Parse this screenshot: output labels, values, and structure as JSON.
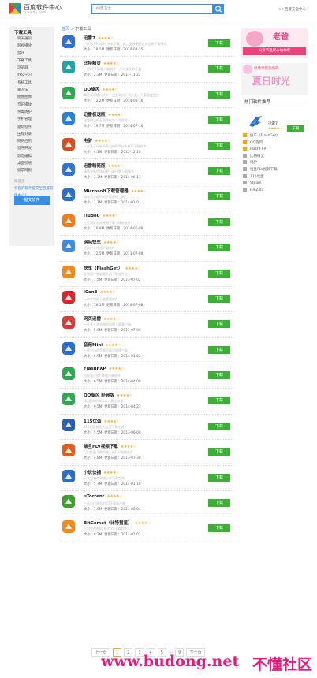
{
  "header": {
    "site_name": "百度软件中心",
    "site_domain": "rj.baidu.com",
    "search_value": "百度卫士",
    "top_link": ">>百度安全中心"
  },
  "sidebar": {
    "title": "下载工具",
    "items": [
      "聊天通讯",
      "影视播放",
      "游戏",
      "下载工具",
      "浏览器",
      "办公学习",
      "系统工具",
      "输入法",
      "图像图像",
      "音乐播放",
      "杀毒防护",
      "手机管理",
      "驱动程序",
      "压缩刻录",
      "网络应用",
      "程序开发",
      "影音编辑",
      "桌面壁纸",
      "股票网银"
    ],
    "welcome": "欢迎您",
    "publish": "将您的软件提交至百度软件中心！",
    "submit_label": "提交软件"
  },
  "breadcrumb": {
    "home": "首页",
    "sep": ">",
    "current": "下载工具"
  },
  "software": [
    {
      "name": "迅雷7",
      "stars": "★★★★☆",
      "desc": "一款基于P2SP技术的下载工具，更快更稳定的全新下载体验",
      "size": "28.5M",
      "date": "2014-07-25",
      "icon": "xunlei-icon",
      "color": "#2f6fd0"
    },
    {
      "name": "比特精灵",
      "stars": "★★★★☆",
      "desc": "一款BT下载客户端软件，支持多任务下载",
      "size": "2.3M",
      "date": "2013-11-22",
      "icon": "bitspirit-icon",
      "color": "#1fa3a3"
    },
    {
      "name": "QQ旋风",
      "stars": "★★★★☆",
      "desc": "腾讯公司推出的新一代互联网下载工具，下载速度更快",
      "size": "12.2M",
      "date": "2014-05-16",
      "icon": "qqxuanfeng-icon",
      "color": "#2fa84f"
    },
    {
      "name": "迅雷极速版",
      "stars": "★★★★☆",
      "desc": "迅雷推出的无插件纯净下载版本",
      "size": "19.7M",
      "date": "2014-07-16",
      "icon": "xunlei-speed-icon",
      "color": "#2a7fd9"
    },
    {
      "name": "电驴",
      "stars": "★★★★☆",
      "desc": "一款基于eMule开发的P2P文件共享下载软件",
      "size": "4.1M",
      "date": "2013-12-10",
      "icon": "verycd-icon",
      "color": "#d94c1f"
    },
    {
      "name": "迅雷精简版",
      "stars": "★★★★☆",
      "desc": "精简安装包体积更小的迅雷下载版本",
      "size": "3.3M",
      "date": "2014-06-13",
      "icon": "xunlei-mini-icon",
      "color": "#2e73d6"
    },
    {
      "name": "Microsoft下载管理器",
      "stars": "★★★★☆",
      "desc": "微软官方提供的下载管理工具",
      "size": "1.2M",
      "date": "2014-01-01",
      "icon": "ms-download-icon",
      "color": "#2a6fc9"
    },
    {
      "name": "iTudou",
      "stars": "★★★★☆",
      "desc": "土豆网推出的视频下载与播放软件",
      "size": "16.8M",
      "date": "2014-06-08",
      "icon": "itudou-icon",
      "color": "#f07c1a"
    },
    {
      "name": "网际快车",
      "stars": "★★★★☆",
      "desc": "经典的多线程下载软件",
      "size": "12.5M",
      "date": "2013-07-09",
      "icon": "flashget-old-icon",
      "color": "#3f8be0"
    },
    {
      "name": "快车（FlashGet）",
      "stars": "★★★★☆",
      "desc": "全球用户数量最多的下载软件之一",
      "size": "7.5M",
      "date": "2013-07-02",
      "icon": "flashget-icon",
      "color": "#f08a1c"
    },
    {
      "name": "iCon3",
      "stars": "★★★★☆",
      "desc": "一款实用的下载管理软件",
      "size": "18.1M",
      "date": "2014-07-08",
      "icon": "icon3-icon",
      "color": "#d9262c"
    },
    {
      "name": "网页迅雷",
      "stars": "★★★★☆",
      "desc": "一款基于浏览器的迅雷下载客户端",
      "size": "5.9M",
      "date": "2013-07-09",
      "icon": "web-xunlei-icon",
      "color": "#d93a3a"
    },
    {
      "name": "音频Mini",
      "stars": "★★★★☆",
      "desc": "一款小巧的音频下载与管理工具",
      "size": "6.9M",
      "date": "2014-01-02",
      "icon": "audio-mini-icon",
      "color": "#2a6fd0"
    },
    {
      "name": "FlashFXP",
      "stars": "★★★★☆",
      "desc": "功能强大的FTP客户端软件",
      "size": "6.5M",
      "date": "2014-04-09",
      "icon": "flashfxp-icon",
      "color": "#2fa84f"
    },
    {
      "name": "QQ旋风 经典版",
      "stars": "★★★★☆",
      "desc": "QQ旋风经典版本，稳定快速",
      "size": "9.5M",
      "date": "2014-04-23",
      "icon": "qqxuanfeng-classic-icon",
      "color": "#2fa84f"
    },
    {
      "name": "115优蛋",
      "stars": "★★★★☆",
      "desc": "115网盘推出的极速下载工具",
      "size": "5.5M",
      "date": "2013-06-09",
      "icon": "115-icon",
      "color": "#2a5fb0"
    },
    {
      "name": "维旦FLV视频下载",
      "stars": "★★★★☆",
      "desc": "可以批量下载网络上的FLV视频文件",
      "size": "4.8M",
      "date": "2013-07-30",
      "icon": "flv-download-icon",
      "color": "#e85a1a"
    },
    {
      "name": "小说快捕",
      "stars": "★★★★☆",
      "desc": "一款方便的网络小说下载工具",
      "size": "5.7M",
      "date": "2014-01-10",
      "icon": "novel-icon",
      "color": "#2a6fc9"
    },
    {
      "name": "uTorrent",
      "stars": "★★★★☆",
      "desc": "一款小巧强劲的BT下载客户端",
      "size": "1.9M",
      "date": "2014-08-04",
      "icon": "utorrent-icon",
      "color": "#3f9e2e"
    },
    {
      "name": "BitComet（比特彗星）",
      "stars": "★★★★☆",
      "desc": "一款免费的BitTorrent下载软件",
      "size": "8.3M",
      "date": "2014-01-02",
      "icon": "bitcomet-icon",
      "color": "#f08a1c"
    }
  ],
  "labels": {
    "download": "下载",
    "size_prefix": "大小：",
    "date_prefix": "更新日期："
  },
  "pager": {
    "prev": "上一页",
    "pages": [
      "1",
      "2",
      "3",
      "4",
      "5"
    ],
    "ellipsis": "...",
    "last": "9",
    "next": "下一页",
    "current": "1"
  },
  "ads": {
    "ad1_title": "老爸",
    "ad1_banner": "父亲节送爱心给你吧",
    "ad2_line1": "尽情享受热情的",
    "ad2_line2": "夏日时光"
  },
  "hot": {
    "title": "热门软件推荐",
    "featured_name": "迅雷7",
    "featured_stars": "★★★★☆",
    "featured_dl": "下载",
    "items": [
      "快车（FlashGet）",
      "QQ旋风",
      "FlashFXP",
      "比特精灵",
      "电驴",
      "维旦FLV视频下载",
      "115优蛋",
      "Steam",
      "FileZilla"
    ]
  },
  "watermark": {
    "url": "www.budong.net",
    "cn": "不懂社区"
  },
  "colors": {
    "accent": "#3a8ee6",
    "download": "#3cb034",
    "stars": "#f5a623",
    "watermark": "#e8197b"
  }
}
